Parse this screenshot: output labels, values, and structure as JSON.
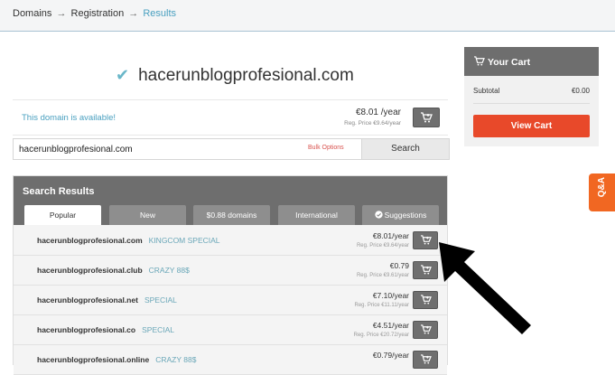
{
  "breadcrumb": {
    "items": [
      "Domains",
      "Registration",
      "Results"
    ],
    "separator": "→"
  },
  "domain": {
    "name": "hacerunblogprofesional.com",
    "available_message": "This domain is available!",
    "price": "€8.01 /year",
    "reg_price": "Reg. Price €9.64/year"
  },
  "search": {
    "value": "hacerunblogprofesional.com",
    "bulk_options": "Bulk Options",
    "button": "Search"
  },
  "results": {
    "title": "Search Results",
    "tabs": [
      {
        "label": "Popular",
        "active": true
      },
      {
        "label": "New",
        "active": false
      },
      {
        "label": "$0.88 domains",
        "active": false
      },
      {
        "label": "International",
        "active": false
      },
      {
        "label": "Suggestions",
        "active": false
      }
    ],
    "rows": [
      {
        "domain": "hacerunblogprofesional.com",
        "tag": "KINGCOM SPECIAL",
        "price": "€8.01/year",
        "reg": "Reg. Price €9.64/year"
      },
      {
        "domain": "hacerunblogprofesional.club",
        "tag": "CRAZY 88$",
        "price": "€0.79",
        "reg": "Reg. Price €9.61/year"
      },
      {
        "domain": "hacerunblogprofesional.net",
        "tag": "SPECIAL",
        "price": "€7.10/year",
        "reg": "Reg. Price €11.11/year"
      },
      {
        "domain": "hacerunblogprofesional.co",
        "tag": "SPECIAL",
        "price": "€4.51/year",
        "reg": "Reg. Price €20.72/year"
      },
      {
        "domain": "hacerunblogprofesional.online",
        "tag": "CRAZY 88$",
        "price": "€0.79/year",
        "reg": ""
      }
    ]
  },
  "cart": {
    "title": "Your Cart",
    "subtotal_label": "Subtotal",
    "subtotal_value": "€0.00",
    "view_button": "View Cart"
  },
  "qa_label": "Q&A",
  "colors": {
    "accent_link": "#4aa0c0",
    "view_cart_button": "#e8492a",
    "qa_tab": "#f16722",
    "header_gray": "#6e6e6e"
  },
  "icons": {
    "check": "check-icon",
    "cart": "cart-icon",
    "suggestions": "check-circle-icon",
    "annotation": "arrow-annotation-icon"
  }
}
